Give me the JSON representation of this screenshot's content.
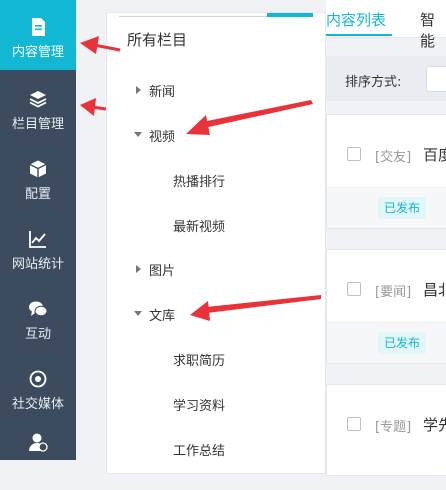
{
  "nav": {
    "items": [
      {
        "label": "内容管理",
        "icon": "document-icon",
        "active": true
      },
      {
        "label": "栏目管理",
        "icon": "layers-icon",
        "active": false
      },
      {
        "label": "配置",
        "icon": "cube-icon",
        "active": false
      },
      {
        "label": "网站统计",
        "icon": "line-chart-icon",
        "active": false
      },
      {
        "label": "互动",
        "icon": "chat-icon",
        "active": false
      },
      {
        "label": "社交媒体",
        "icon": "social-icon",
        "active": false
      },
      {
        "label": "",
        "icon": "user-check-icon",
        "active": false
      }
    ]
  },
  "tree": {
    "title": "所有栏目",
    "nodes": [
      {
        "label": "新闻",
        "state": "collapsed"
      },
      {
        "label": "视频",
        "state": "expanded"
      },
      {
        "label": "热播排行",
        "state": "leaf"
      },
      {
        "label": "最新视频",
        "state": "leaf"
      },
      {
        "label": "图片",
        "state": "collapsed"
      },
      {
        "label": "文库",
        "state": "expanded"
      },
      {
        "label": "求职简历",
        "state": "leaf"
      },
      {
        "label": "学习资料",
        "state": "leaf"
      },
      {
        "label": "工作总结",
        "state": "leaf"
      }
    ]
  },
  "tabs": {
    "active": "内容列表",
    "second": "智能"
  },
  "sort": {
    "label": "排序方式:"
  },
  "cards": [
    {
      "tag": "[交友]",
      "title": "百度",
      "status": "已发布"
    },
    {
      "tag": "[要闻]",
      "title": "昌北",
      "status": "已发布"
    },
    {
      "tag": "[专题]",
      "title": "学先",
      "status": ""
    }
  ],
  "colors": {
    "accent": "#12b7d4",
    "nav_bg": "#3c4b5d",
    "annotation": "#e8333a"
  }
}
